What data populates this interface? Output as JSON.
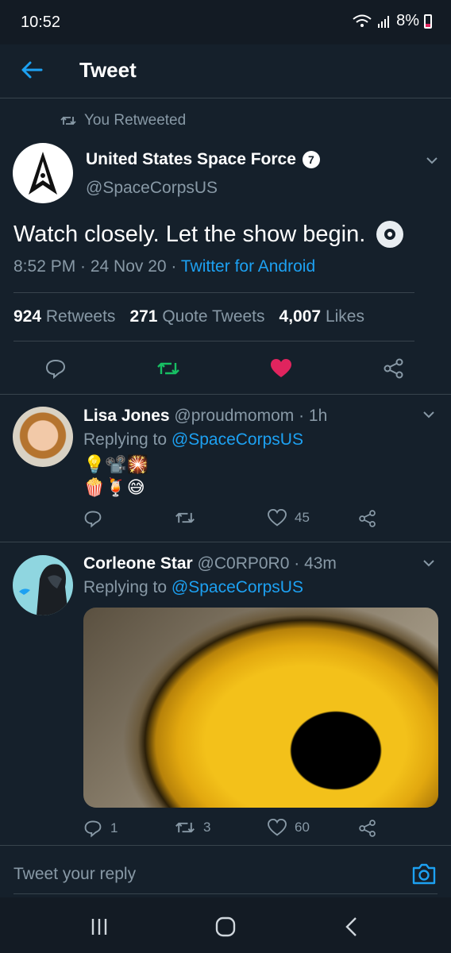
{
  "status_bar": {
    "time": "10:52",
    "battery": "8%"
  },
  "header": {
    "title": "Tweet"
  },
  "retweet_banner": {
    "text": "You Retweeted"
  },
  "main_tweet": {
    "name": "United States Space Force",
    "verified_badge": "7",
    "handle": "@SpaceCorpsUS",
    "text": "Watch closely. Let the show begin.",
    "time": "8:52 PM · 24 Nov 20 · ",
    "source": "Twitter for Android",
    "stats": {
      "retweets_count": "924",
      "retweets_label": "Retweets",
      "quotes_count": "271",
      "quotes_label": "Quote Tweets",
      "likes_count": "4,007",
      "likes_label": "Likes"
    },
    "colors": {
      "retweet": "#17bf63",
      "like": "#e0245e"
    }
  },
  "replies": [
    {
      "name": "Lisa Jones",
      "handle_time": "@proudmomom · 1h",
      "replying_prefix": "Replying to ",
      "replying_handle": "@SpaceCorpsUS",
      "emoji_line1": "💡📽️🎇",
      "emoji_line2": "🍿🍹😅",
      "reply_count": "",
      "retweet_count": "",
      "like_count": "45"
    },
    {
      "name": "Corleone Star",
      "handle_time": "@C0RP0R0 · 43m",
      "replying_prefix": "Replying to ",
      "replying_handle": "@SpaceCorpsUS",
      "image": "owl-eye-photo",
      "reply_count": "1",
      "retweet_count": "3",
      "like_count": "60"
    }
  ],
  "reply_bar": {
    "placeholder": "Tweet your reply"
  },
  "icons": [
    "back-arrow-icon",
    "retweet-icon",
    "verified-icon",
    "chevron-down-icon",
    "reply-icon",
    "like-icon",
    "share-icon",
    "camera-icon"
  ]
}
